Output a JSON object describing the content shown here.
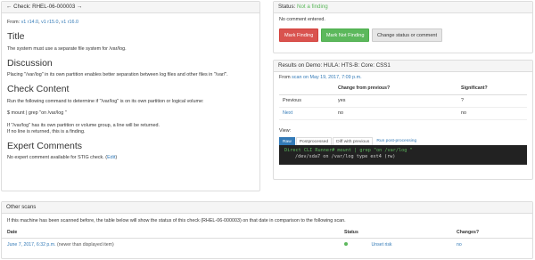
{
  "check": {
    "heading_prefix": "Check:",
    "heading_id": "RHEL-06-000003",
    "back_arrow_glyph": "←",
    "forward_arrow_glyph": "→",
    "from_label": "From:",
    "versions": [
      "v1 r14.0",
      "v1 r15.0",
      "v1 r16.0"
    ],
    "title_heading": "Title",
    "title_text": "The system must use a separate file system for /var/log.",
    "discussion_heading": "Discussion",
    "discussion_text": "Placing \"/var/log\" in its own partition enables better separation between log files and other files in \"/var/\".",
    "content_heading": "Check Content",
    "content_intro": "Run the following command to determine if \"/var/log\" is on its own partition or logical volume:",
    "content_command": "$ mount | grep \"on /var/log \"",
    "content_result_1": "If \"/var/log\" has its own partition or volume group, a line will be returned.",
    "content_result_2": "If no line is returned, this is a finding.",
    "expert_heading": "Expert Comments",
    "expert_text": "No expert comment available for STIG check. (",
    "expert_edit": "Edit",
    "expert_text_end": ")"
  },
  "status": {
    "label": "Status:",
    "value": "Not a finding",
    "comment": "No comment entered.",
    "buttons": {
      "mark_finding": "Mark Finding",
      "mark_not_finding": "Mark Not Finding",
      "change": "Change status or comment"
    }
  },
  "results": {
    "heading": "Results on Demo: HULA: HTS-B: Core: CSS1",
    "from_prefix": "From",
    "from_link": "scan on May 19, 2017, 7:09 p.m.",
    "columns": [
      "",
      "Change from previous?",
      "",
      "Significant?"
    ],
    "rows": [
      {
        "label": "Previous",
        "change": "yes",
        "significant": "?"
      },
      {
        "label": "Next",
        "change": "no",
        "significant": "no"
      }
    ],
    "view_label": "View:",
    "tabs": [
      "Raw",
      "Postprocessed",
      "Diff with previous",
      "Run post-processing"
    ],
    "terminal_line1_prompt": "Direct CLI Runner# mount | grep \"on /var/log \"",
    "terminal_line2": "/dev/sda7 on /var/log type ext4 (rw)"
  },
  "other_scans": {
    "heading": "Other scans",
    "intro": "If this machine has been scanned before, the table below will show the status of this check (RHEL-06-000003) on that date in comparison to the following scan.",
    "columns": [
      "Date",
      "Status",
      "Changes?"
    ],
    "rows": [
      {
        "date": "June 7, 2017, 6:32 p.m.",
        "note": "(newer than displayed item)",
        "status": "Unset risk",
        "changes": "no"
      }
    ]
  },
  "colors": {
    "accent": "#337ab7",
    "success": "#5cb85c",
    "danger": "#d9534f"
  }
}
